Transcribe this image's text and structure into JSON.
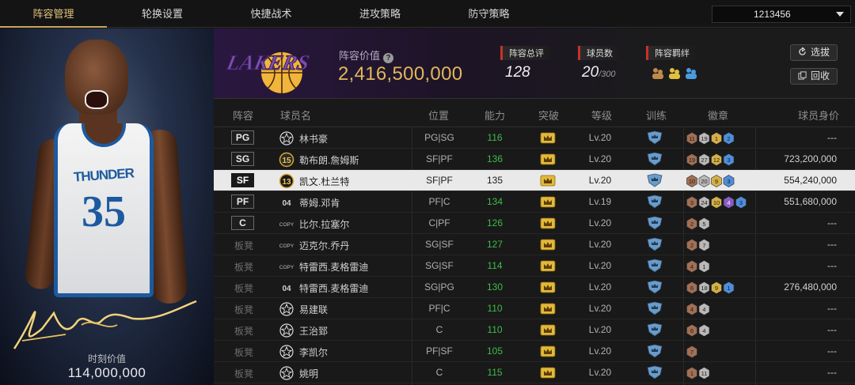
{
  "tabs": [
    {
      "label": "阵容管理",
      "active": true
    },
    {
      "label": "轮换设置",
      "active": false
    },
    {
      "label": "快捷战术",
      "active": false
    },
    {
      "label": "进攻策略",
      "active": false
    },
    {
      "label": "防守策略",
      "active": false
    }
  ],
  "account": {
    "id": "1213456"
  },
  "featured": {
    "jersey_team": "THUNDER",
    "jersey_number": "35",
    "moment_value_label": "时刻价值",
    "moment_value": "114,000,000"
  },
  "team": {
    "logo_text": "LAKERS",
    "value_label": "阵容价值",
    "value": "2,416,500,000",
    "rating_label": "阵容总评",
    "rating": "128",
    "players_label": "球员数",
    "players": "20",
    "players_max": "/300",
    "bonds_label": "阵容羁绊"
  },
  "buttons": {
    "select": "选拔",
    "recycle": "回收"
  },
  "columns": {
    "slot": "阵容",
    "name": "球员名",
    "pos": "位置",
    "power": "能力",
    "breakthrough": "突破",
    "level": "等级",
    "training": "训练",
    "badges": "徽章",
    "value": "球员身价"
  },
  "rows": [
    {
      "slot": "PG",
      "bench": false,
      "icon": "star",
      "name": "林书豪",
      "pos": "PG|SG",
      "power": "116",
      "power_up": true,
      "level": "Lv.20",
      "badges": [
        "11",
        "19",
        "1",
        "2"
      ],
      "badge_colors": [
        "bronze",
        "silver",
        "gold",
        "blue"
      ],
      "value": "---",
      "selected": false
    },
    {
      "slot": "SG",
      "bench": false,
      "icon": "num",
      "icon_text": "15",
      "name": "勒布朗.詹姆斯",
      "pos": "SF|PF",
      "power": "136",
      "power_up": true,
      "level": "Lv.20",
      "badges": [
        "19",
        "27",
        "12",
        "3"
      ],
      "badge_colors": [
        "bronze",
        "silver",
        "gold",
        "blue"
      ],
      "value": "723,200,000",
      "selected": false
    },
    {
      "slot": "SF",
      "bench": false,
      "icon": "num",
      "icon_text": "13",
      "name": "凯文.杜兰特",
      "pos": "SF|PF",
      "power": "135",
      "power_up": false,
      "level": "Lv.20",
      "badges": [
        "10",
        "20",
        "9",
        "3"
      ],
      "badge_colors": [
        "bronze",
        "silver",
        "gold",
        "blue"
      ],
      "value": "554,240,000",
      "selected": true
    },
    {
      "slot": "PF",
      "bench": false,
      "icon": "text",
      "icon_text": "04",
      "name": "蒂姆.邓肯",
      "pos": "PF|C",
      "power": "134",
      "power_up": true,
      "level": "Lv.19",
      "badges": [
        "3",
        "24",
        "10",
        "4",
        "3"
      ],
      "badge_colors": [
        "bronze",
        "silver",
        "gold",
        "purple",
        "blue"
      ],
      "value": "551,680,000",
      "selected": false
    },
    {
      "slot": "C",
      "bench": false,
      "icon": "copy",
      "icon_text": "COPY",
      "name": "比尔.拉塞尔",
      "pos": "C|PF",
      "power": "126",
      "power_up": true,
      "level": "Lv.20",
      "badges": [
        "2",
        "5"
      ],
      "badge_colors": [
        "bronze",
        "silver"
      ],
      "value": "---",
      "selected": false
    },
    {
      "slot": "板凳",
      "bench": true,
      "icon": "copy",
      "icon_text": "COPY",
      "name": "迈克尔.乔丹",
      "pos": "SG|SF",
      "power": "127",
      "power_up": true,
      "level": "Lv.20",
      "badges": [
        "2",
        "7"
      ],
      "badge_colors": [
        "bronze",
        "silver"
      ],
      "value": "---",
      "selected": false
    },
    {
      "slot": "板凳",
      "bench": true,
      "icon": "copy",
      "icon_text": "COPY",
      "name": "特雷西.麦格雷迪",
      "pos": "SG|SF",
      "power": "114",
      "power_up": true,
      "level": "Lv.20",
      "badges": [
        "4",
        "1"
      ],
      "badge_colors": [
        "bronze",
        "silver"
      ],
      "value": "---",
      "selected": false
    },
    {
      "slot": "板凳",
      "bench": true,
      "icon": "text",
      "icon_text": "04",
      "name": "特雷西.麦格雷迪",
      "pos": "SG|PG",
      "power": "130",
      "power_up": true,
      "level": "Lv.20",
      "badges": [
        "6",
        "18",
        "9",
        "1"
      ],
      "badge_colors": [
        "bronze",
        "silver",
        "gold",
        "blue"
      ],
      "value": "276,480,000",
      "selected": false
    },
    {
      "slot": "板凳",
      "bench": true,
      "icon": "star",
      "name": "易建联",
      "pos": "PF|C",
      "power": "110",
      "power_up": true,
      "level": "Lv.20",
      "badges": [
        "4",
        "4"
      ],
      "badge_colors": [
        "bronze",
        "silver"
      ],
      "value": "---",
      "selected": false
    },
    {
      "slot": "板凳",
      "bench": true,
      "icon": "star",
      "name": "王治郅",
      "pos": "C",
      "power": "110",
      "power_up": true,
      "level": "Lv.20",
      "badges": [
        "6",
        "4"
      ],
      "badge_colors": [
        "bronze",
        "silver"
      ],
      "value": "---",
      "selected": false
    },
    {
      "slot": "板凳",
      "bench": true,
      "icon": "star",
      "name": "李凯尔",
      "pos": "PF|SF",
      "power": "105",
      "power_up": true,
      "level": "Lv.20",
      "badges": [
        "7"
      ],
      "badge_colors": [
        "bronze"
      ],
      "value": "---",
      "selected": false
    },
    {
      "slot": "板凳",
      "bench": true,
      "icon": "star",
      "name": "姚明",
      "pos": "C",
      "power": "115",
      "power_up": true,
      "level": "Lv.20",
      "badges": [
        "1",
        "11"
      ],
      "badge_colors": [
        "bronze",
        "silver"
      ],
      "value": "---",
      "selected": false
    }
  ],
  "colors": {
    "gold": "#e2b65c",
    "accent_tab": "#c9a45c",
    "power_green": "#3fbc48",
    "brand_purple": "#552583",
    "brand_gold": "#fdb927"
  }
}
